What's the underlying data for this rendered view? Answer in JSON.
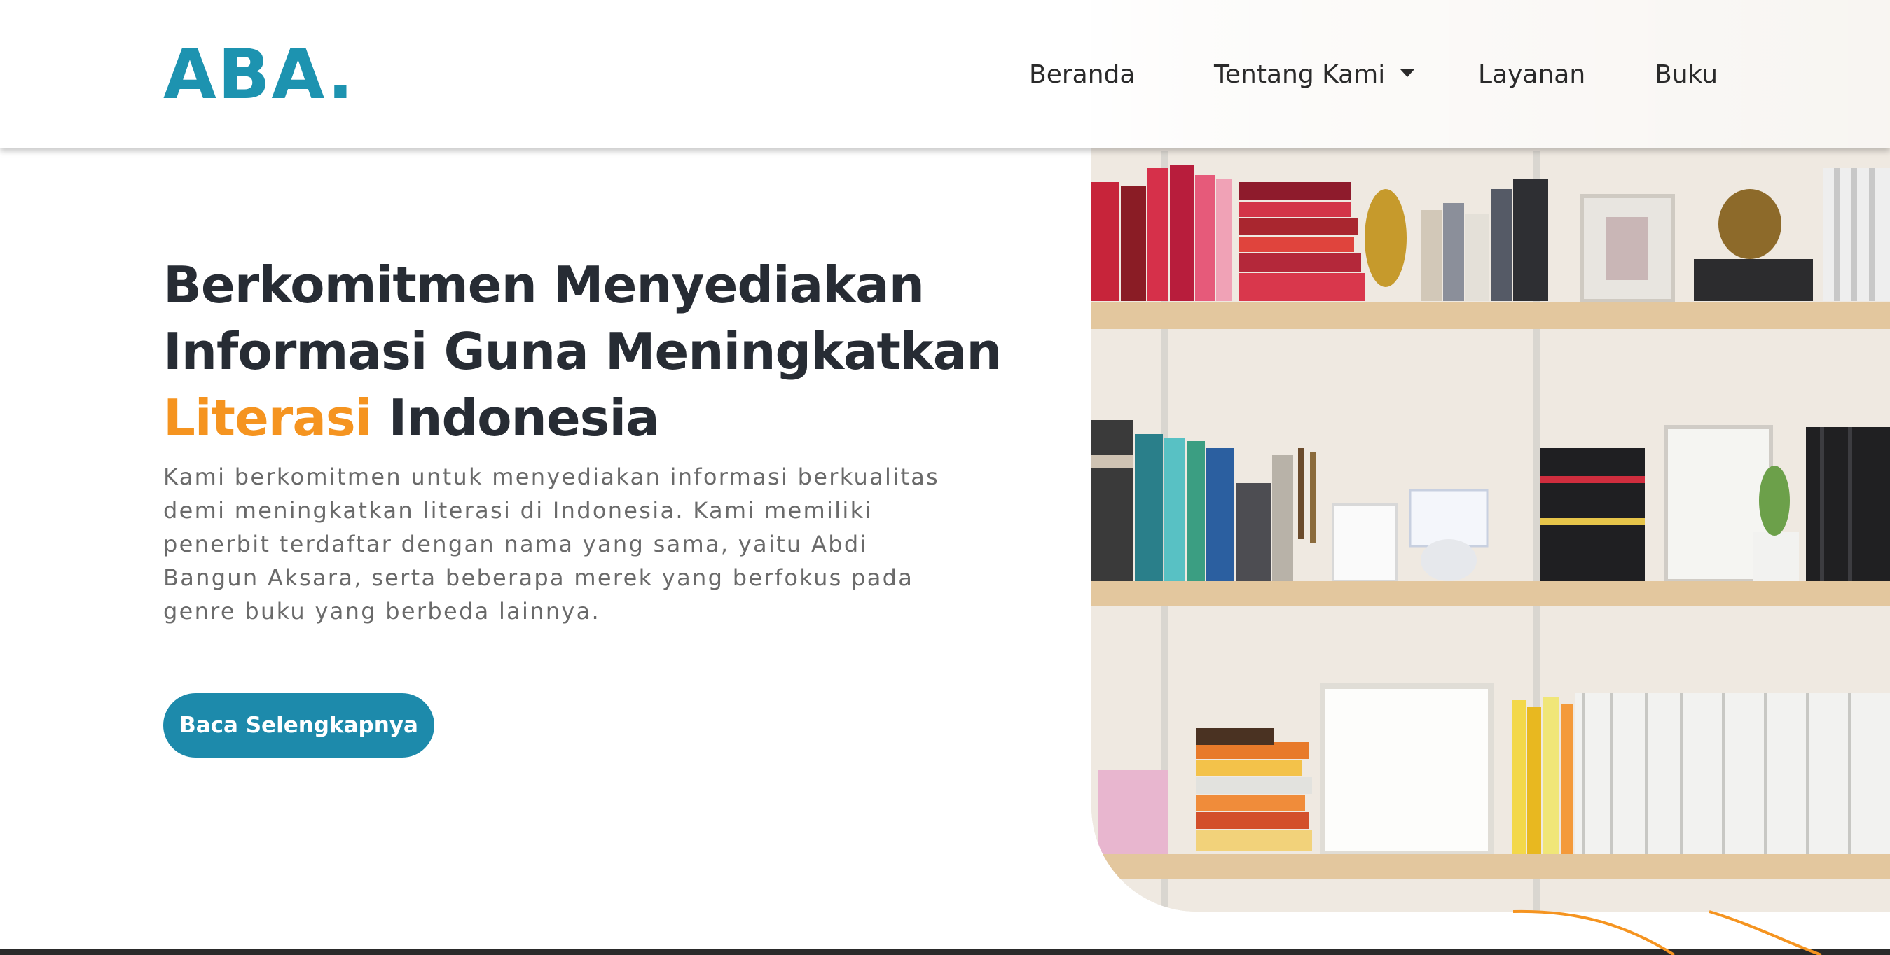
{
  "brand": {
    "logo_text": "ABA."
  },
  "nav": {
    "items": [
      {
        "label": "Beranda"
      },
      {
        "label": "Tentang Kami",
        "has_dropdown": true
      },
      {
        "label": "Layanan"
      },
      {
        "label": "Buku"
      }
    ]
  },
  "hero": {
    "title_line1": "Berkomitmen Menyediakan",
    "title_line2": "Informasi Guna Meningkatkan",
    "title_accent": "Literasi",
    "title_end": " Indonesia",
    "description": "Kami berkomitmen untuk menyediakan informasi berkualitas demi meningkatkan literasi di Indonesia. Kami memiliki penerbit terdaftar dengan nama yang sama, yaitu Abdi Bangun Aksara, serta beberapa merek yang berfokus pada genre buku yang berbeda lainnya.",
    "cta_label": "Baca Selengkapnya",
    "image_alt_icon": "bookshelf-photo"
  },
  "colors": {
    "brand": "#1d93b0",
    "accent": "#f59420",
    "button": "#1d8aab",
    "title": "#272c34",
    "body_text": "#6a6a6a"
  }
}
